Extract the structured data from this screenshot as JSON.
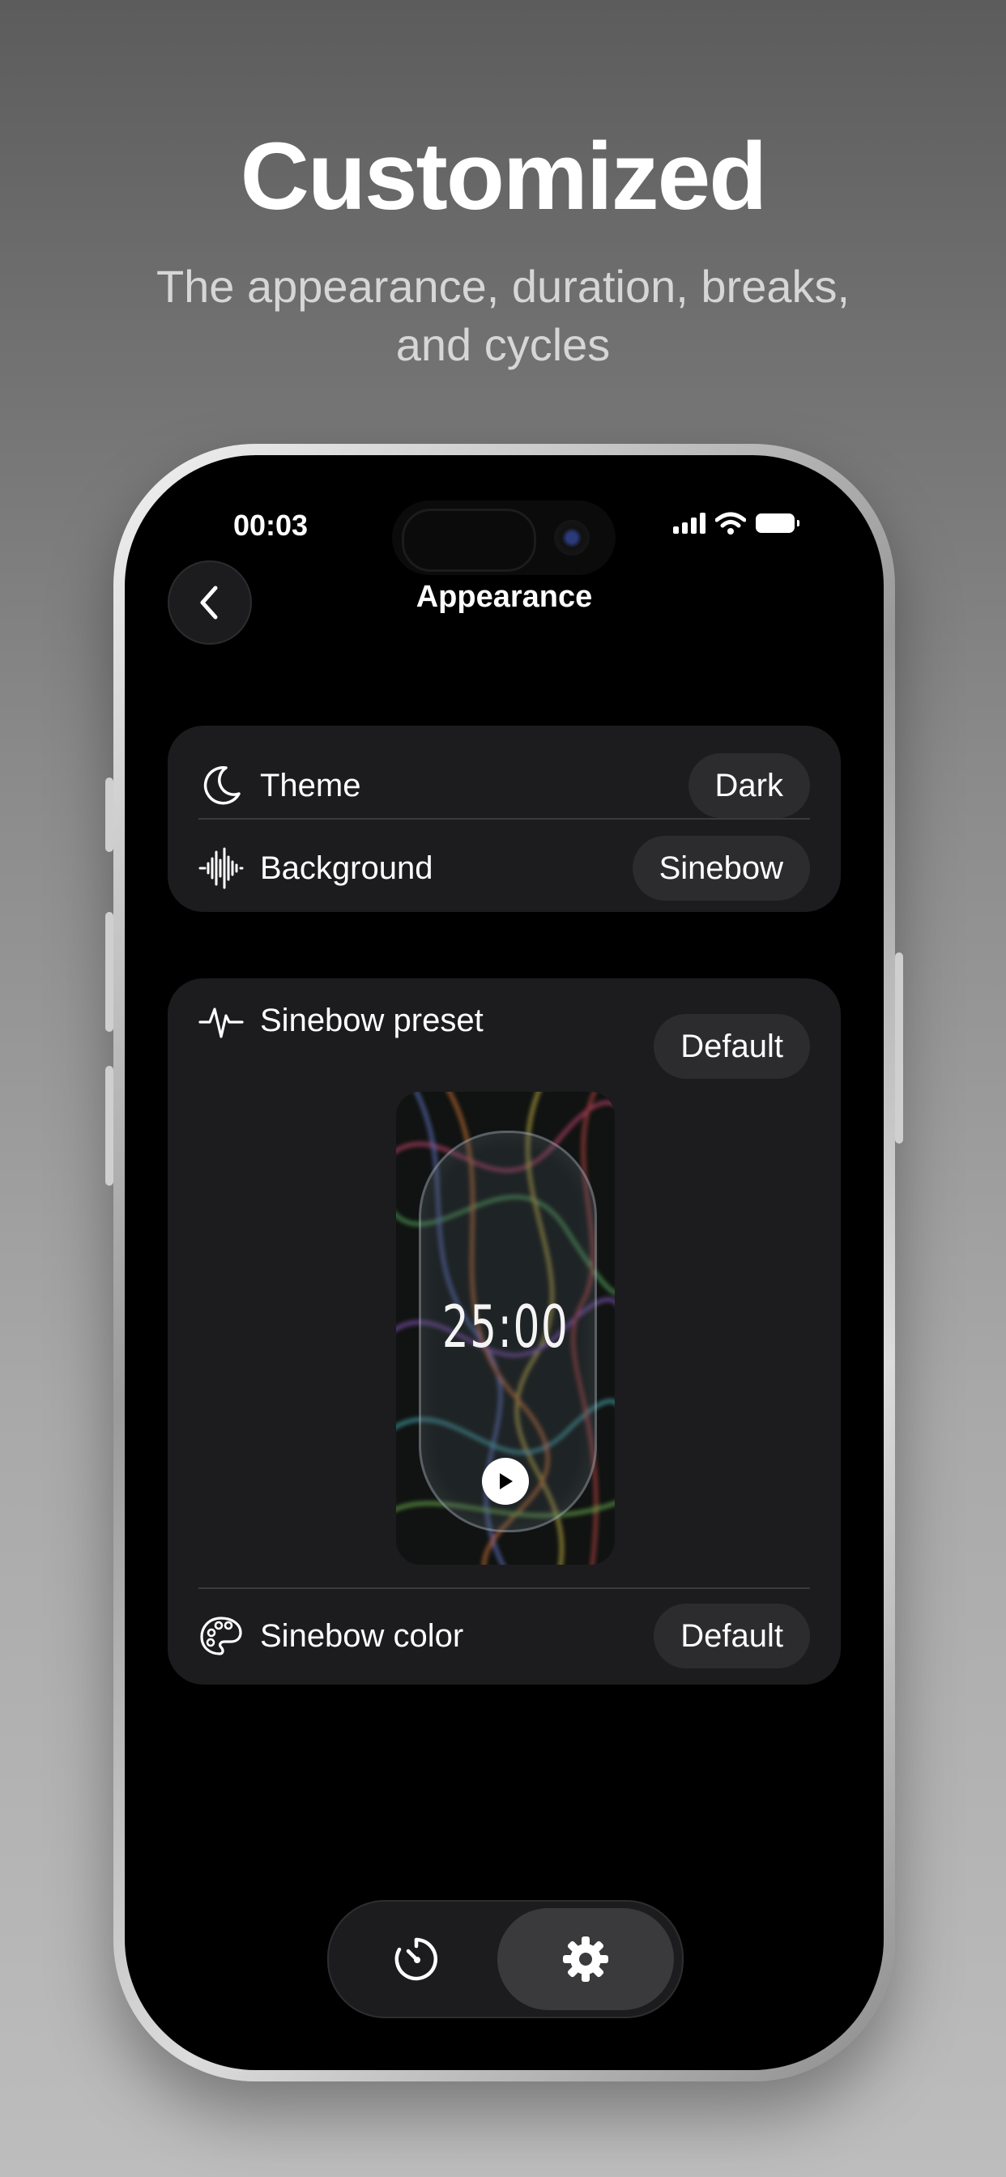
{
  "marketing": {
    "headline": "Customized",
    "subheadline": "The appearance, duration, breaks, and cycles"
  },
  "status_bar": {
    "time": "00:03",
    "icons": [
      "cellular-signal-icon",
      "wifi-icon",
      "battery-icon"
    ]
  },
  "nav": {
    "back_icon": "chevron-left-icon",
    "title": "Appearance"
  },
  "settings_group_1": {
    "rows": [
      {
        "icon": "moon-icon",
        "label": "Theme",
        "value": "Dark"
      },
      {
        "icon": "waveform-icon",
        "label": "Background",
        "value": "Sinebow"
      }
    ]
  },
  "settings_group_2": {
    "preset": {
      "icon": "pulse-icon",
      "label": "Sinebow preset",
      "value": "Default"
    },
    "preview": {
      "timer": "25:00",
      "play_icon": "play-icon"
    },
    "color": {
      "icon": "palette-icon",
      "label": "Sinebow color",
      "value": "Default"
    }
  },
  "tab_bar": {
    "tabs": [
      {
        "icon": "timer-icon",
        "selected": false
      },
      {
        "icon": "gear-icon",
        "selected": true
      }
    ]
  },
  "colors": {
    "background_top": "#5c5c5c",
    "screen": "#000000",
    "card": "#1c1c1e",
    "chip": "#2c2c2e",
    "text": "#ffffff"
  }
}
